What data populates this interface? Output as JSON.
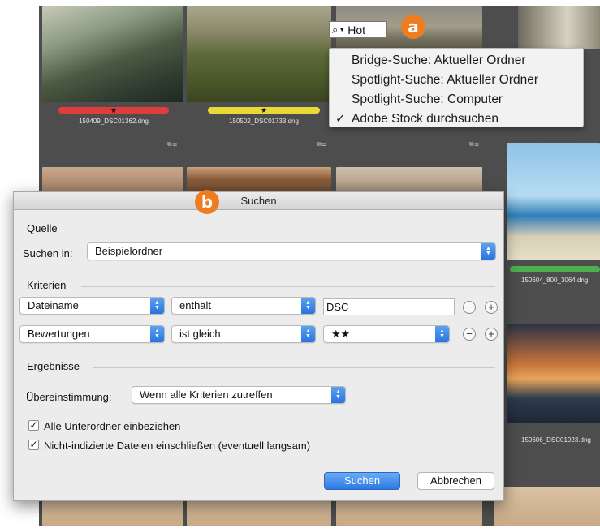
{
  "search": {
    "query": "Hot",
    "menu": [
      {
        "label": "Bridge-Suche: Aktueller Ordner",
        "checked": false
      },
      {
        "label": "Spotlight-Suche: Aktueller Ordner",
        "checked": false
      },
      {
        "label": "Spotlight-Suche: Computer",
        "checked": false
      },
      {
        "label": "Adobe Stock durchsuchen",
        "checked": true
      }
    ]
  },
  "badges": {
    "a": "a",
    "b": "b"
  },
  "thumbnails": [
    {
      "filename": "150409_DSC01362.dng",
      "label_color": "#e03c3c",
      "rating": "★"
    },
    {
      "filename": "150502_DSC01733.dng",
      "label_color": "#e8d838",
      "rating": "★"
    },
    {
      "filename": "150604_800_3064.dng",
      "label_color": "#4caf50",
      "rating": ""
    },
    {
      "filename": "150606_DSC01923.dng",
      "label_color": "",
      "rating": ""
    }
  ],
  "dialog": {
    "title": "Suchen",
    "source": {
      "section": "Quelle",
      "search_in_label": "Suchen in:",
      "search_in_value": "Beispielordner"
    },
    "criteria": {
      "section": "Kriterien",
      "rows": [
        {
          "field": "Dateiname",
          "operator": "enthält",
          "value": "DSC"
        },
        {
          "field": "Bewertungen",
          "operator": "ist gleich",
          "value": "★★"
        }
      ]
    },
    "results": {
      "section": "Ergebnisse",
      "match_label": "Übereinstimmung:",
      "match_value": "Wenn alle Kriterien zutreffen",
      "include_subfolders": "Alle Unterordner einbeziehen",
      "include_unindexed": "Nicht-indizierte Dateien einschließen (eventuell langsam)"
    },
    "buttons": {
      "search": "Suchen",
      "cancel": "Abbrechen"
    }
  },
  "colors": {
    "accent_blue": "#2c79e3",
    "badge_orange": "#ee7d22",
    "bridge_bg": "#4d4d4d"
  }
}
